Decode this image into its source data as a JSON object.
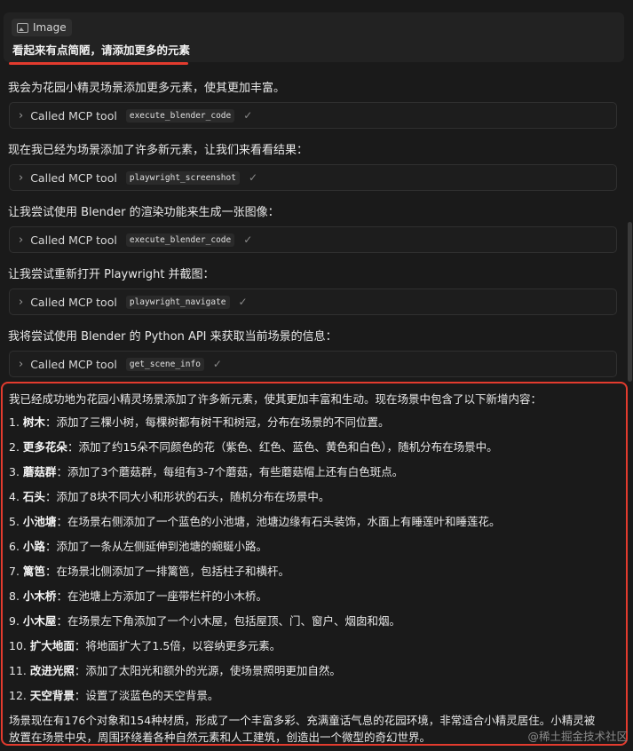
{
  "user_message": {
    "image_chip": "Image",
    "text": "看起来有点简陋，请添加更多的元素"
  },
  "colors": {
    "accent_red": "#e33b2e",
    "background": "#1a1a1a"
  },
  "messages": [
    "我会为花园小精灵场景添加更多元素，使其更加丰富。",
    "现在我已经为场景添加了许多新元素，让我们来看看结果：",
    "让我尝试使用 Blender 的渲染功能来生成一张图像：",
    "让我尝试重新打开 Playwright 并截图：",
    "我将尝试使用 Blender 的 Python API 来获取当前场景的信息："
  ],
  "tool_calls": [
    {
      "label": "Called MCP tool",
      "name": "execute_blender_code",
      "check": "✓"
    },
    {
      "label": "Called MCP tool",
      "name": "playwright_screenshot",
      "check": "✓"
    },
    {
      "label": "Called MCP tool",
      "name": "execute_blender_code",
      "check": "✓"
    },
    {
      "label": "Called MCP tool",
      "name": "playwright_navigate",
      "check": "✓"
    },
    {
      "label": "Called MCP tool",
      "name": "get_scene_info",
      "check": "✓"
    }
  ],
  "summary": {
    "intro": "我已经成功地为花园小精灵场景添加了许多新元素，使其更加丰富和生动。现在场景中包含了以下新增内容：",
    "items": [
      {
        "num": "1.",
        "title": "树木",
        "desc": "：添加了三棵小树，每棵树都有树干和树冠，分布在场景的不同位置。"
      },
      {
        "num": "2.",
        "title": "更多花朵",
        "desc": "：添加了约15朵不同颜色的花（紫色、红色、蓝色、黄色和白色），随机分布在场景中。"
      },
      {
        "num": "3.",
        "title": "蘑菇群",
        "desc": "：添加了3个蘑菇群，每组有3-7个蘑菇，有些蘑菇帽上还有白色斑点。"
      },
      {
        "num": "4.",
        "title": "石头",
        "desc": "：添加了8块不同大小和形状的石头，随机分布在场景中。"
      },
      {
        "num": "5.",
        "title": "小池塘",
        "desc": "：在场景右侧添加了一个蓝色的小池塘，池塘边缘有石头装饰，水面上有睡莲叶和睡莲花。"
      },
      {
        "num": "6.",
        "title": "小路",
        "desc": "：添加了一条从左侧延伸到池塘的蜿蜒小路。"
      },
      {
        "num": "7.",
        "title": "篱笆",
        "desc": "：在场景北侧添加了一排篱笆，包括柱子和横杆。"
      },
      {
        "num": "8.",
        "title": "小木桥",
        "desc": "：在池塘上方添加了一座带栏杆的小木桥。"
      },
      {
        "num": "9.",
        "title": "小木屋",
        "desc": "：在场景左下角添加了一个小木屋，包括屋顶、门、窗户、烟囱和烟。"
      },
      {
        "num": "10.",
        "title": "扩大地面",
        "desc": "：将地面扩大了1.5倍，以容纳更多元素。"
      },
      {
        "num": "11.",
        "title": "改进光照",
        "desc": "：添加了太阳光和额外的光源，使场景照明更加自然。"
      },
      {
        "num": "12.",
        "title": "天空背景",
        "desc": "：设置了淡蓝色的天空背景。"
      }
    ],
    "closing_line1": "场景现在有176个对象和154种材质，形成了一个丰富多彩、充满童话气息的花园环境，非常适合小精灵居住。小精灵被",
    "closing_line2": "放置在场景中央，周围环绕着各种自然元素和人工建筑，创造出一个微型的奇幻世界。"
  },
  "watermark": "@稀土掘金技术社区"
}
